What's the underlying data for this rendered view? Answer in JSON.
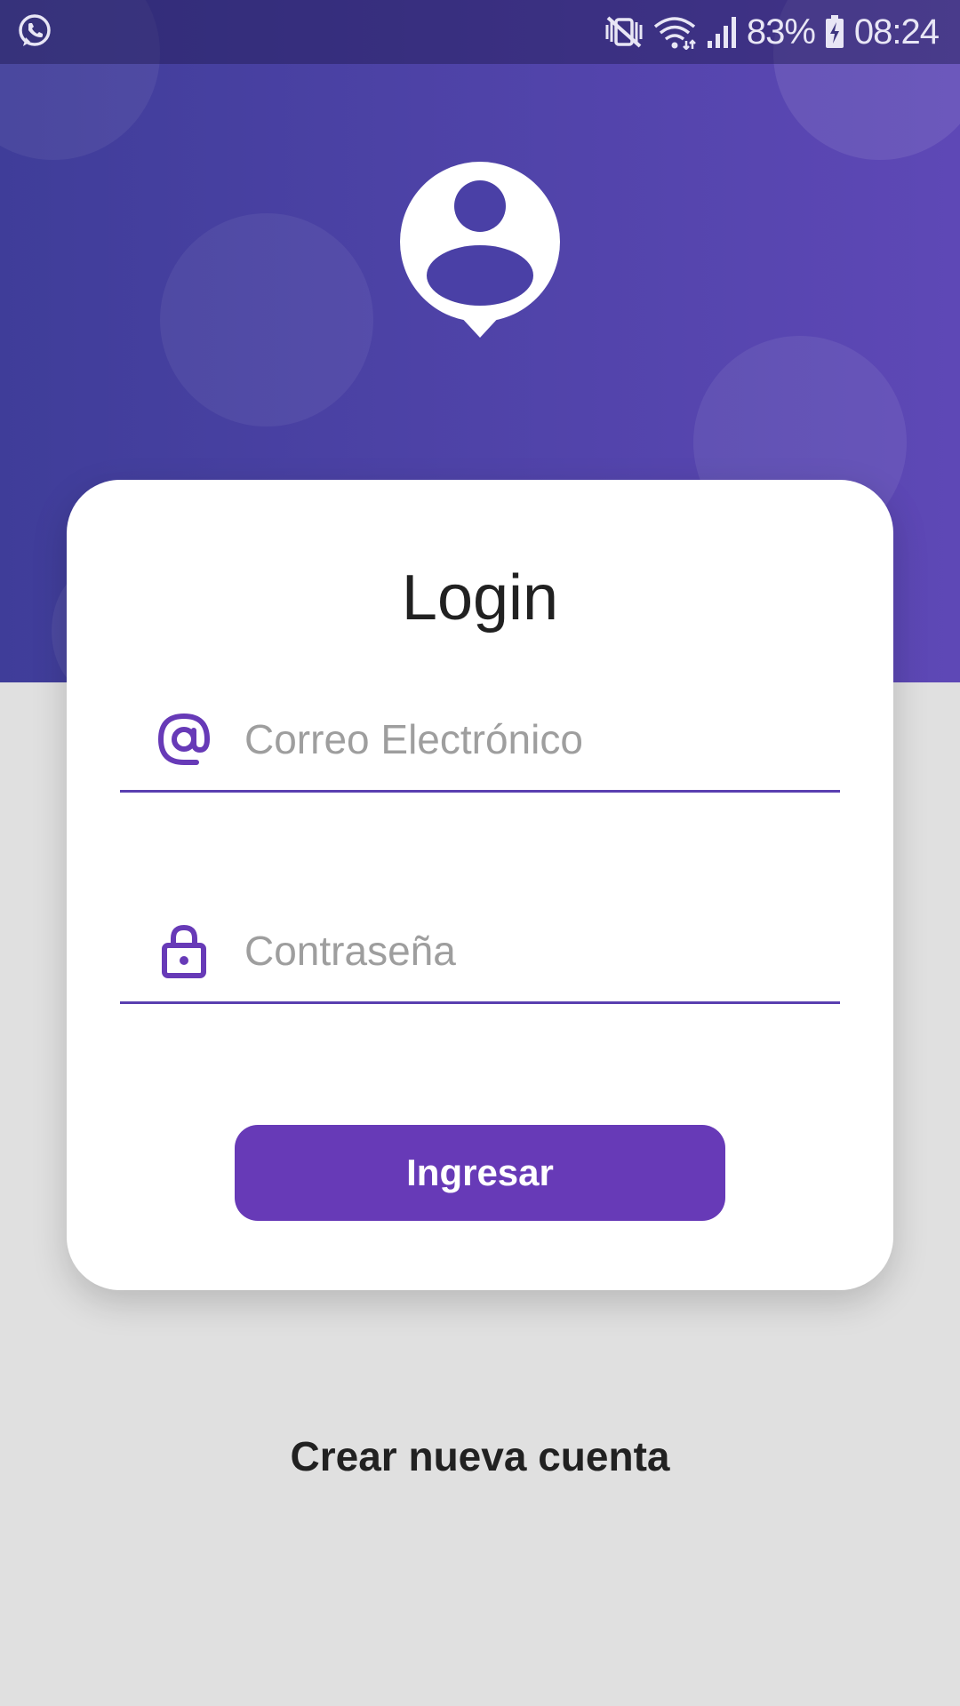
{
  "status_bar": {
    "battery_percent": "83%",
    "time": "08:24",
    "icons": [
      "whatsapp-icon",
      "vibrate-mute-icon",
      "wifi-icon",
      "signal-icon",
      "battery-charging-icon"
    ]
  },
  "header": {
    "logo_icon": "user-location-pin-icon"
  },
  "login": {
    "title": "Login",
    "email": {
      "icon": "at-sign-icon",
      "placeholder": "Correo Electrónico",
      "value": ""
    },
    "password": {
      "icon": "lock-icon",
      "placeholder": "Contraseña",
      "value": ""
    },
    "submit_label": "Ingresar"
  },
  "footer": {
    "create_account_label": "Crear nueva cuenta"
  },
  "colors": {
    "primary": "#673ab7",
    "header_gradient_start": "#3f3d99",
    "header_gradient_end": "#5e48b6",
    "background": "#e0e0e0"
  }
}
